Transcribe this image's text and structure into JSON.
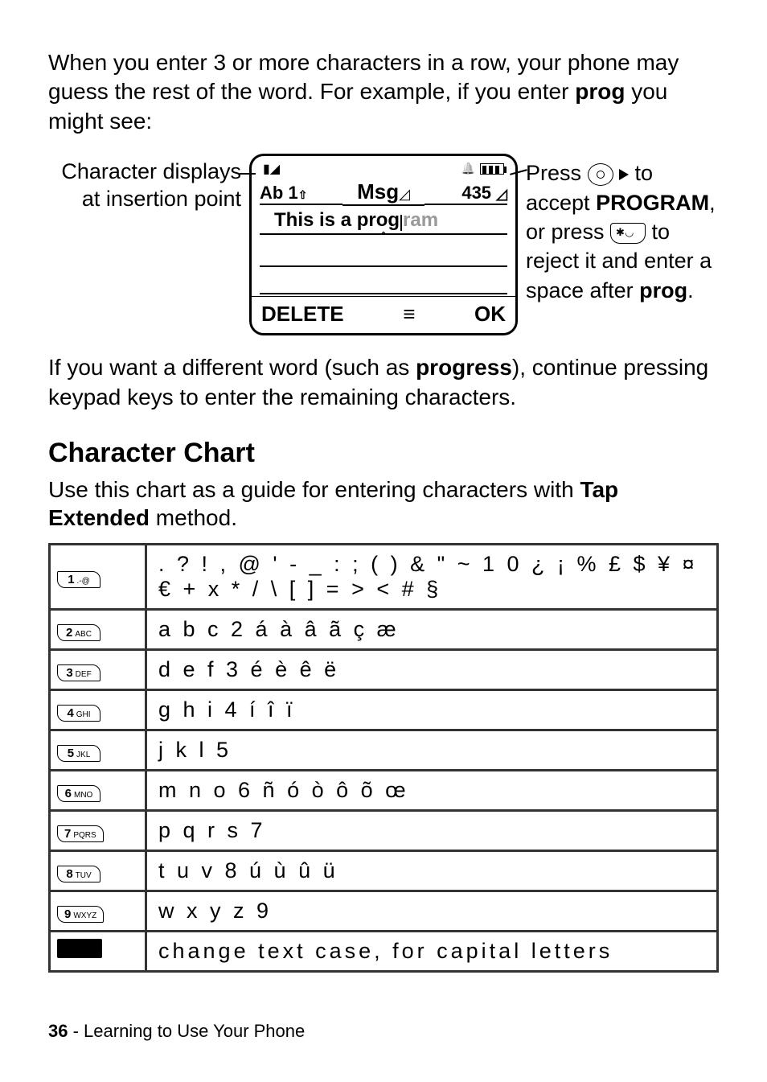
{
  "intro_pre": "When you enter 3 or more characters in a row, your phone may guess the rest of the word. For example, if you enter ",
  "intro_bold": "prog",
  "intro_post": " you might see:",
  "diagram": {
    "left_label_line1": "Character displays",
    "left_label_line2": "at insertion point",
    "screen": {
      "mode": "Ab 1",
      "title": "Msg",
      "count": "435",
      "typed": "This is a prog",
      "suggestion": "ram",
      "delete": "DELETE",
      "ok": "OK"
    },
    "right_label_pre": "Press ",
    "right_label_mid1": " to accept ",
    "right_label_program": "PROGRAM",
    "right_label_mid2": ", or press ",
    "right_label_mid3": " to reject it and enter a space after ",
    "right_label_prog": "prog",
    "right_label_end": "."
  },
  "para2_pre": "If you want a different word (such as ",
  "para2_bold": "progress",
  "para2_post": "), continue pressing keypad keys to enter the remaining characters.",
  "section_heading": "Character Chart",
  "chart_intro_pre": "Use this chart as a guide for entering characters with ",
  "chart_intro_bold": "Tap Extended",
  "chart_intro_post": " method.",
  "chart": [
    {
      "key": "1",
      "sub": ".-@",
      "chars": ". ? ! , @ ' - _ : ; ( ) & \" ~ 1 0 ¿ ¡ % £ $ ¥ ¤ € + x * / \\ [ ] = > < # §"
    },
    {
      "key": "2",
      "sub": "ABC",
      "chars": "a b c 2 á à â ã ç æ"
    },
    {
      "key": "3",
      "sub": "DEF",
      "chars": "d e f 3 é è ê ë"
    },
    {
      "key": "4",
      "sub": "GHI",
      "chars": "g h i 4 í î ï"
    },
    {
      "key": "5",
      "sub": "JKL",
      "chars": "j k l 5"
    },
    {
      "key": "6",
      "sub": "MNO",
      "chars": "m n o 6 ñ ó ò ô õ œ"
    },
    {
      "key": "7",
      "sub": "PQRS",
      "chars": "p q r s 7"
    },
    {
      "key": "8",
      "sub": "TUV",
      "chars": "t u v 8 ú ù û ü"
    },
    {
      "key": "9",
      "sub": "WXYZ",
      "chars": "w x y z 9"
    },
    {
      "key": "black",
      "sub": "",
      "chars": "change text case, for capital letters"
    }
  ],
  "footer_page": "36",
  "footer_text": " - Learning to Use Your Phone"
}
